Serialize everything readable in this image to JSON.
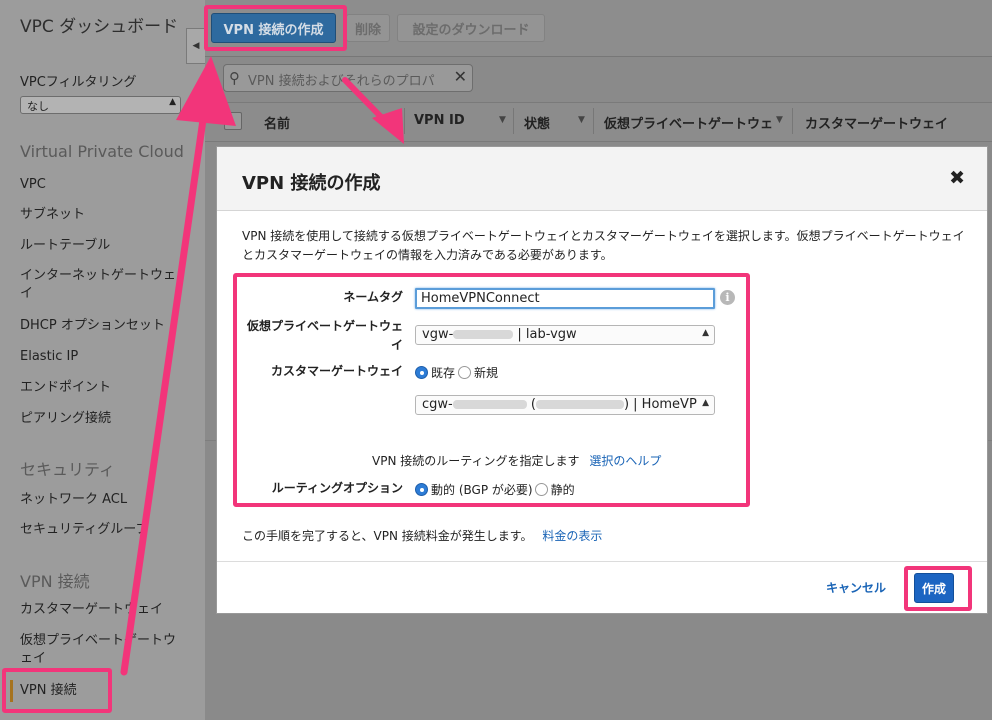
{
  "sidebar": {
    "title": "VPC ダッシュボード",
    "filter_label": "VPCフィルタリング",
    "filter_value": "なし",
    "section_vpc": "Virtual Private Cloud",
    "vpc_items": [
      "VPC",
      "サブネット",
      "ルートテーブル",
      "インターネットゲートウェイ",
      "DHCP オプションセット",
      "Elastic IP",
      "エンドポイント",
      "ピアリング接続"
    ],
    "section_security": "セキュリティ",
    "security_items": [
      "ネットワーク ACL",
      "セキュリティグループ"
    ],
    "section_vpn": "VPN 接続",
    "vpn_items": [
      "カスタマーゲートウェイ",
      "仮想プライベートゲートウェイ",
      "VPN 接続"
    ]
  },
  "toolbar": {
    "create_label": "VPN 接続の作成",
    "delete_label": "削除",
    "download_label": "設定のダウンロード"
  },
  "search": {
    "placeholder": "VPN 接続およびそれらのプロパ"
  },
  "table": {
    "columns": [
      "名前",
      "VPN ID",
      "状態",
      "仮想プライベートゲートウェ",
      "カスタマーゲートウェイ"
    ]
  },
  "modal": {
    "title": "VPN 接続の作成",
    "description": "VPN 接続を使用して接続する仮想プライベートゲートウェイとカスタマーゲートウェイを選択します。仮想プライベートゲートウェイとカスタマーゲートウェイの情報を入力済みである必要があります。",
    "name_tag_label": "ネームタグ",
    "name_tag_value": "HomeVPNConnect",
    "vgw_label": "仮想プライベートゲートウェイ",
    "vgw_prefix": "vgw-",
    "vgw_suffix": "| lab-vgw",
    "cgw_label": "カスタマーゲートウェイ",
    "cgw_existing": "既存",
    "cgw_new": "新規",
    "cgw_prefix": "cgw-",
    "cgw_suffix": ") | HomeVP",
    "routing_note": "VPN 接続のルーティングを指定します",
    "routing_help": "選択のヘルプ",
    "routing_label": "ルーティングオプション",
    "routing_dynamic": "動的 (BGP が必要)",
    "routing_static": "静的",
    "cost_note": "この手順を完了すると、VPN 接続料金が発生します。",
    "cost_link": "料金の表示",
    "cancel_label": "キャンセル",
    "create_label": "作成"
  },
  "colors": {
    "highlight": "#f2357a",
    "primary_button": "#1c65c2",
    "link": "#1a64b6"
  }
}
